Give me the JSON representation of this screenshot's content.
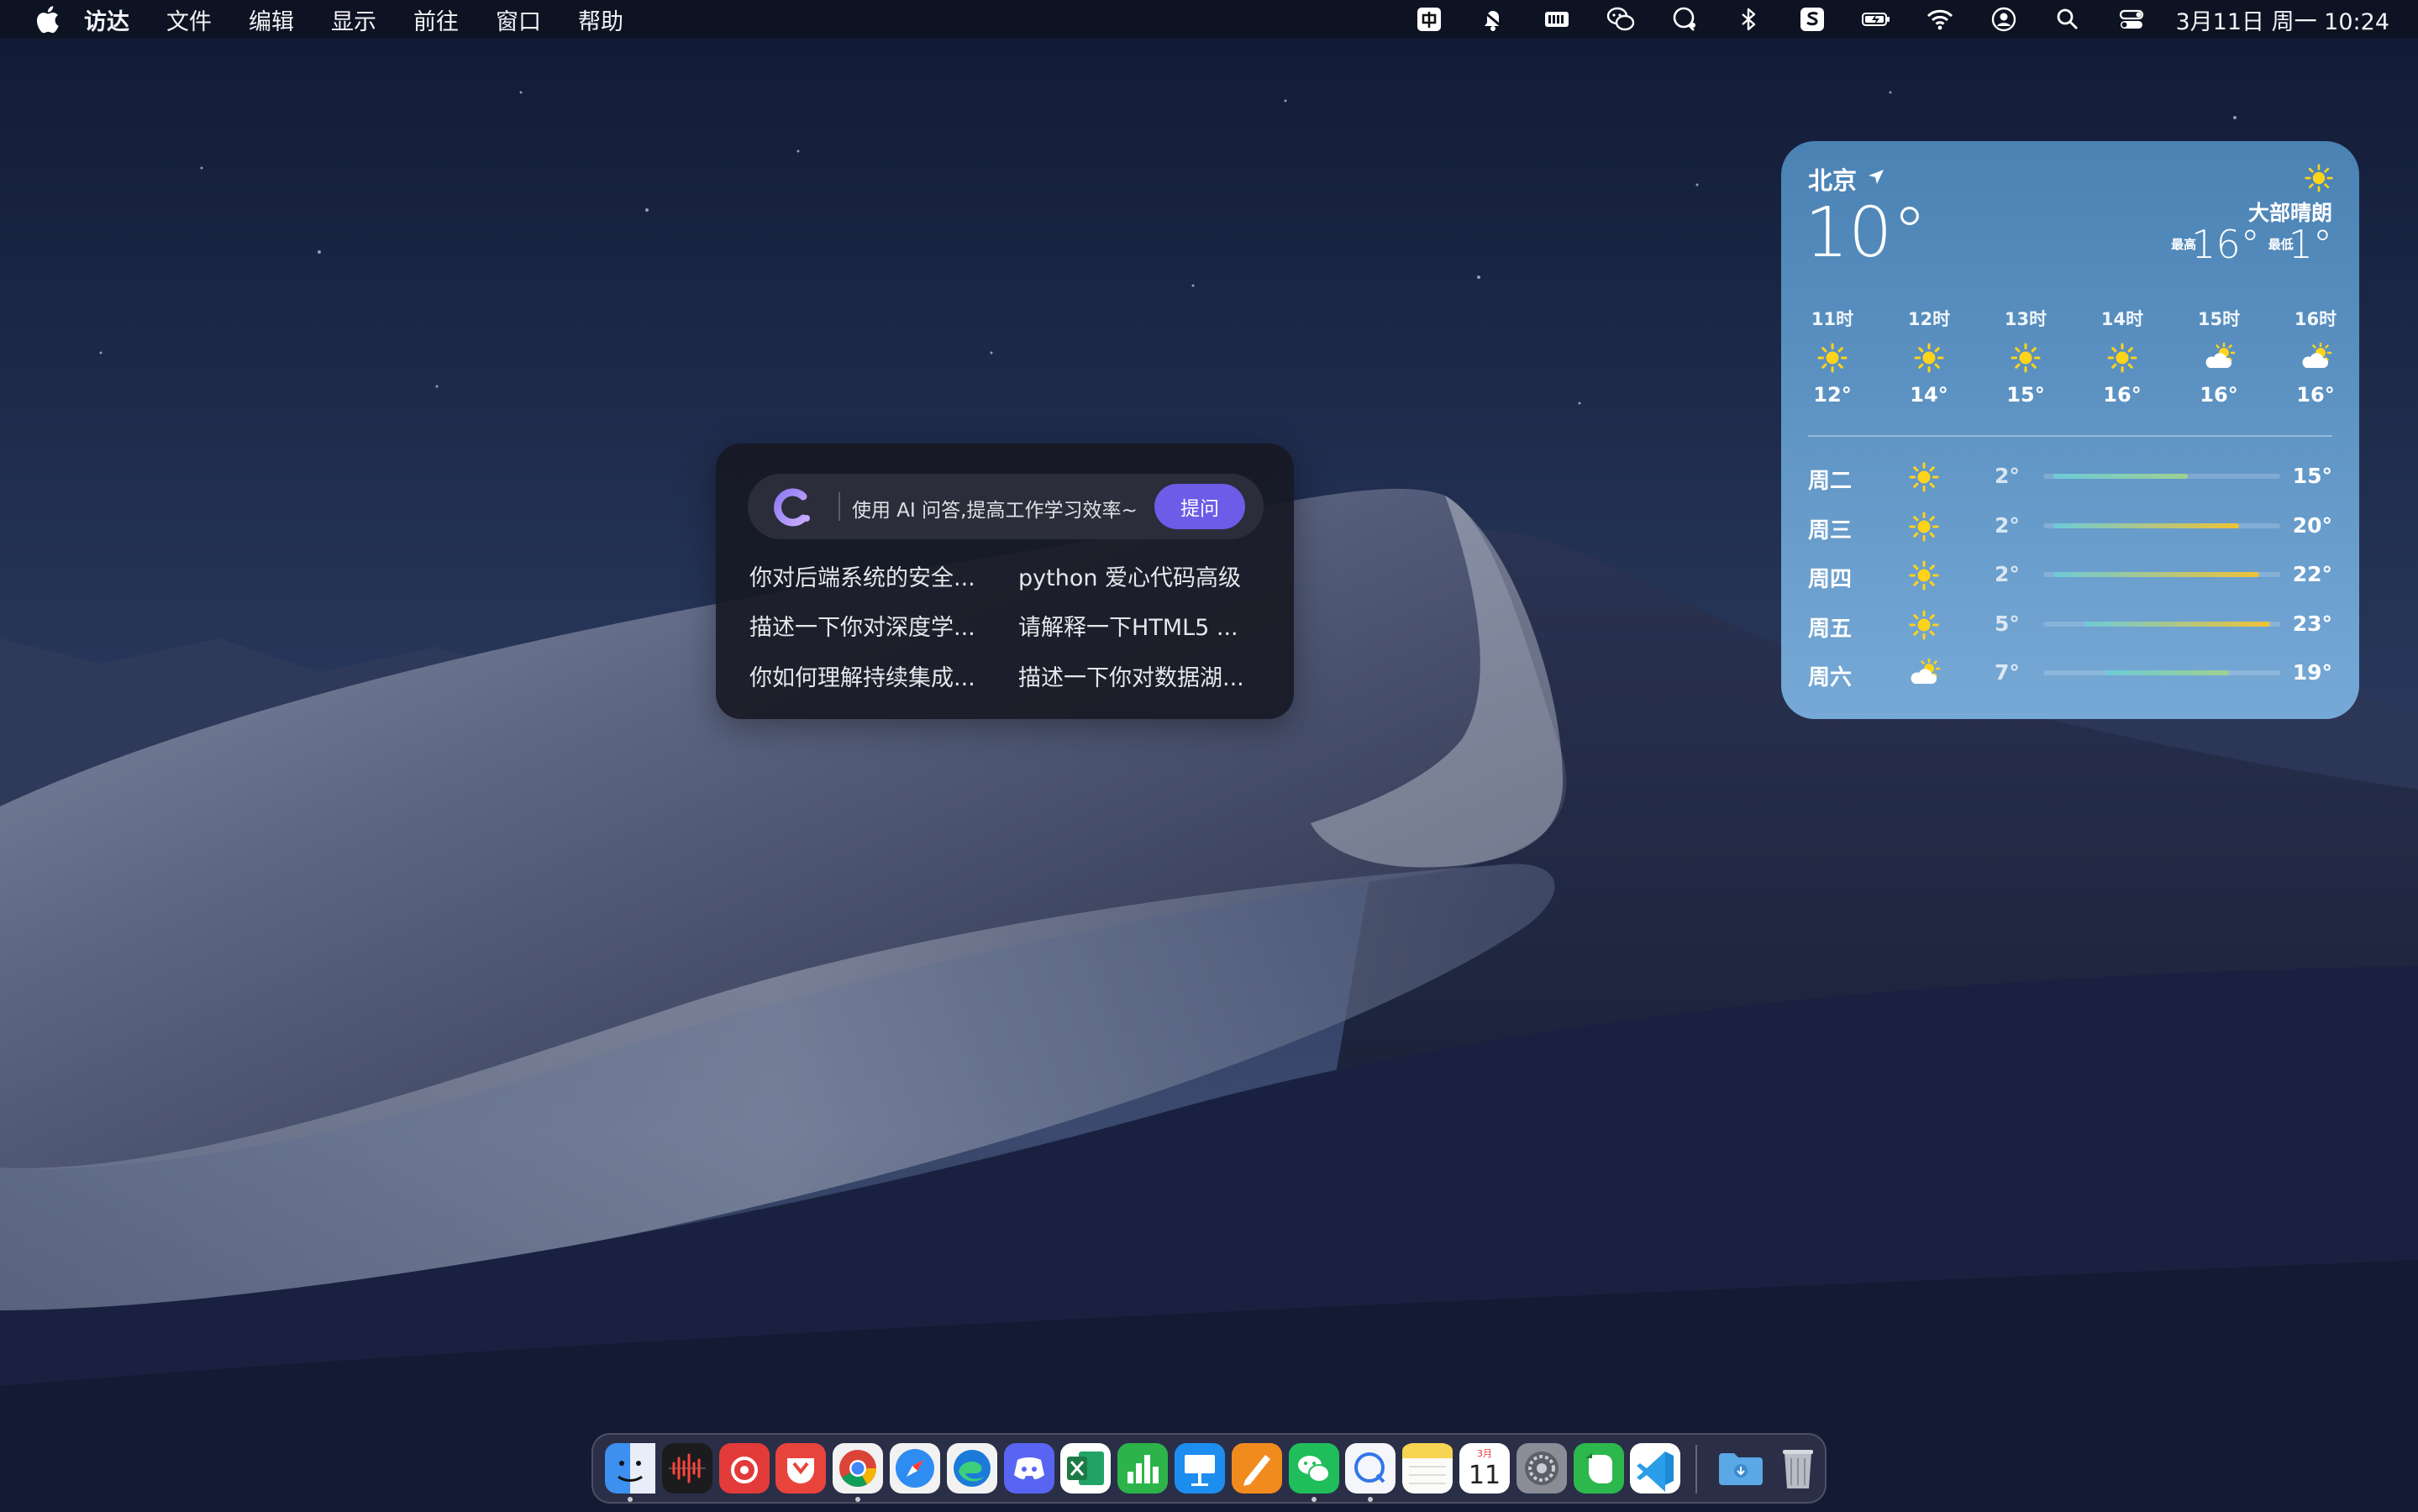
{
  "menubar": {
    "app_name": "访达",
    "menus": [
      "文件",
      "编辑",
      "显示",
      "前往",
      "窗口",
      "帮助"
    ],
    "status_icons": [
      "input-method-icon",
      "notification-icon",
      "keyboard-icon",
      "wechat-icon",
      "chat-bubble-icon",
      "bluetooth-icon",
      "app-s-icon",
      "battery-charging-icon",
      "wifi-icon",
      "user-icon",
      "spotlight-search-icon",
      "control-center-icon"
    ],
    "clock": "3月11日 周一  10:24"
  },
  "ai_widget": {
    "placeholder": "使用 AI 问答,提高工作学习效率~",
    "ask_button": "提问",
    "suggestions": [
      "你对后端系统的安全...",
      "python 爱心代码高级",
      "描述一下你对深度学...",
      "请解释一下HTML5 ...",
      "你如何理解持续集成...",
      "描述一下你对数据湖..."
    ]
  },
  "weather": {
    "city": "北京",
    "current_temp": "10°",
    "condition": "大部晴朗",
    "high_label": "最高",
    "high": "16°",
    "low_label": "最低",
    "low": "1°",
    "hourly": [
      {
        "time": "11时",
        "icon": "sun-icon",
        "temp": "12°"
      },
      {
        "time": "12时",
        "icon": "sun-icon",
        "temp": "14°"
      },
      {
        "time": "13时",
        "icon": "sun-icon",
        "temp": "15°"
      },
      {
        "time": "14时",
        "icon": "sun-icon",
        "temp": "16°"
      },
      {
        "time": "15时",
        "icon": "partly-cloudy-icon",
        "temp": "16°"
      },
      {
        "time": "16时",
        "icon": "partly-cloudy-icon",
        "temp": "16°"
      }
    ],
    "daily": [
      {
        "day": "周二",
        "icon": "sun-icon",
        "low": "2°",
        "high": "15°",
        "low_value": 2,
        "high_value": 15
      },
      {
        "day": "周三",
        "icon": "sun-icon",
        "low": "2°",
        "high": "20°",
        "low_value": 2,
        "high_value": 20
      },
      {
        "day": "周四",
        "icon": "sun-icon",
        "low": "2°",
        "high": "22°",
        "low_value": 2,
        "high_value": 22
      },
      {
        "day": "周五",
        "icon": "sun-icon",
        "low": "5°",
        "high": "23°",
        "low_value": 5,
        "high_value": 23
      },
      {
        "day": "周六",
        "icon": "partly-cloudy-icon",
        "low": "7°",
        "high": "19°",
        "low_value": 7,
        "high_value": 19
      }
    ]
  },
  "dock": {
    "apps": [
      {
        "name": "finder",
        "color": "#3d8ff0",
        "running": true
      },
      {
        "name": "voice-memos",
        "color": "#1c1c1e",
        "running": false
      },
      {
        "name": "netease-music",
        "color": "#e33a3a",
        "running": false
      },
      {
        "name": "app-red",
        "color": "#e8443c",
        "running": false
      },
      {
        "name": "chrome",
        "color": "#f2f2f2",
        "running": true
      },
      {
        "name": "safari",
        "color": "#2f8cf2",
        "running": false
      },
      {
        "name": "edge",
        "color": "#1c7ad8",
        "running": false
      },
      {
        "name": "discord",
        "color": "#5865f2",
        "running": false
      },
      {
        "name": "excel",
        "color": "#1d7a45",
        "running": false
      },
      {
        "name": "numbers",
        "color": "#2cb44a",
        "running": false
      },
      {
        "name": "keynote",
        "color": "#1d8ef0",
        "running": false
      },
      {
        "name": "pages",
        "color": "#f28b1d",
        "running": false
      },
      {
        "name": "wechat",
        "color": "#1fbe5a",
        "running": true
      },
      {
        "name": "chat-app",
        "color": "#f4f6fb",
        "running": true
      },
      {
        "name": "notes",
        "color": "#f7d451",
        "running": false
      },
      {
        "name": "calendar",
        "color": "#ffffff",
        "running": false
      },
      {
        "name": "system-settings",
        "color": "#8a8d96",
        "running": false
      },
      {
        "name": "evernote",
        "color": "#2db84d",
        "running": false
      },
      {
        "name": "vscode",
        "color": "#1e8ad6",
        "running": false
      },
      {
        "name": "downloads-folder",
        "color": "#5aa9e6",
        "running": false
      },
      {
        "name": "trash",
        "color": "#b8bcc6",
        "running": false
      }
    ],
    "calendar_month": "3月",
    "calendar_day": "11"
  },
  "colors": {
    "accent": "#6c5ce8",
    "weather_bg": "#5d93c3",
    "sun": "#ffd31a"
  }
}
